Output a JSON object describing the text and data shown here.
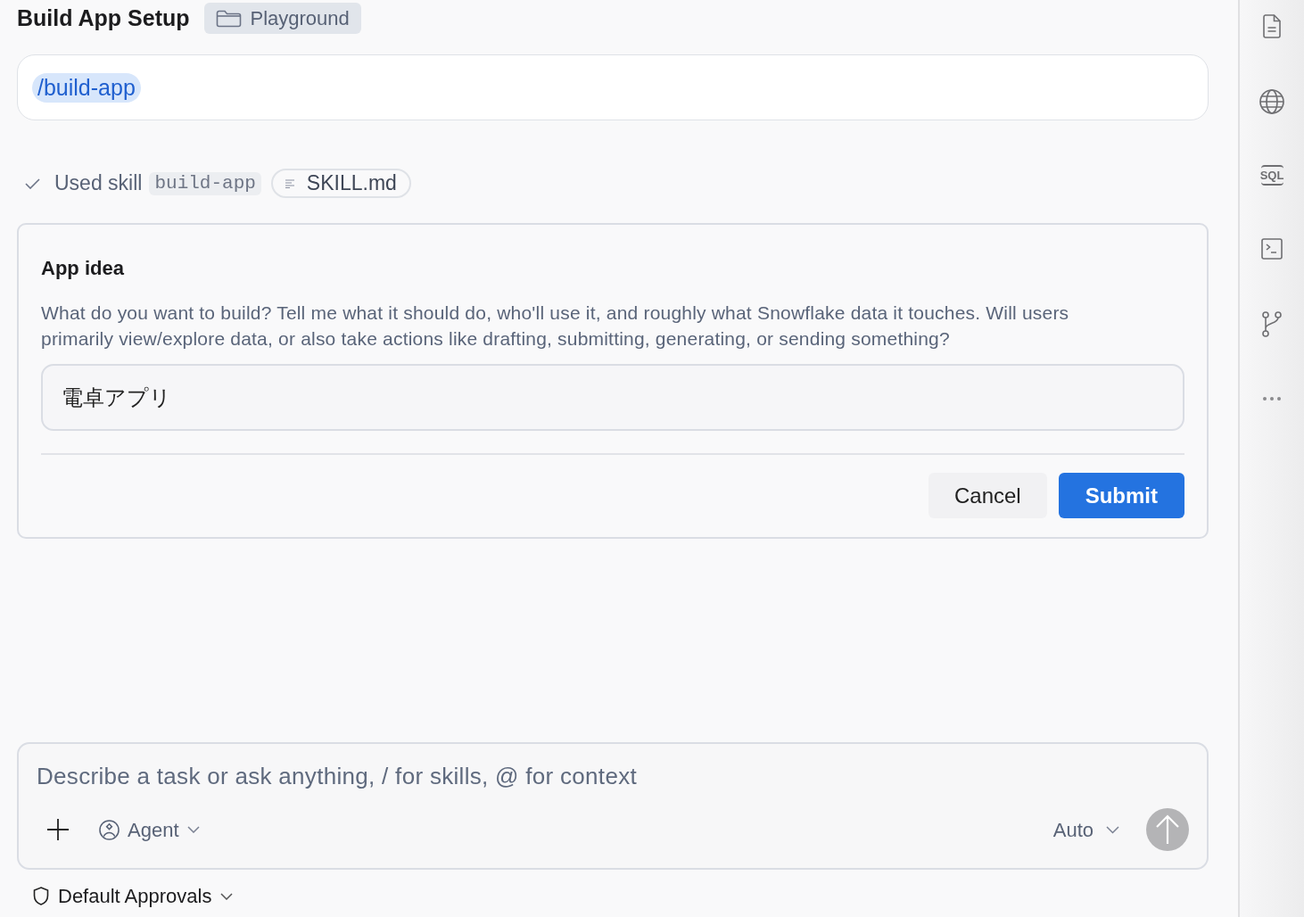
{
  "header": {
    "title": "Build App Setup",
    "workspace": "Playground"
  },
  "message": {
    "command": "/build-app"
  },
  "skill_status": {
    "label": "Used skill",
    "skill": "build-app",
    "file": "SKILL.md"
  },
  "question": {
    "title": "App idea",
    "description": "What do you want to build? Tell me what it should do, who'll use it, and roughly what Snowflake data it touches. Will users primarily view/explore data, or also take actions like drafting, submitting, generating, or sending something?",
    "answer": "電卓アプリ",
    "buttons": [
      {
        "label": "Cancel",
        "kind": "secondary"
      },
      {
        "label": "Submit",
        "kind": "primary"
      }
    ]
  },
  "composer": {
    "placeholder": "Describe a task or ask anything, / for skills, @ for context",
    "mode": "Agent",
    "model": "Auto",
    "send": {
      "disabled": true
    }
  },
  "approvals": {
    "label": "Default Approvals"
  },
  "sidebar": {
    "sql_label": "SQL"
  }
}
